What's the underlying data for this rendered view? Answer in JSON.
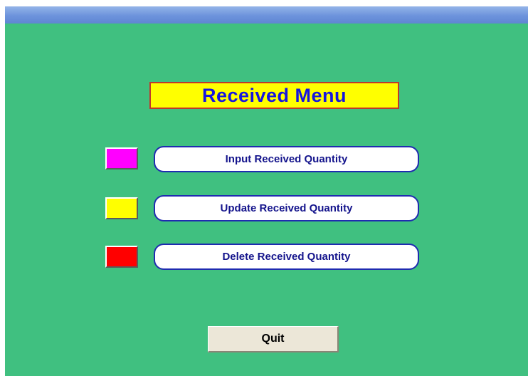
{
  "window": {
    "background": "#40c080",
    "titlebar_color": "#6d93dc"
  },
  "heading": {
    "text": "Received Menu",
    "background": "#ffff00",
    "text_color": "#1515e0"
  },
  "menu": {
    "items": [
      {
        "label": "Input Received Quantity",
        "swatch_color": "#ff00ff"
      },
      {
        "label": "Update Received Quantity",
        "swatch_color": "#ffff00"
      },
      {
        "label": "Delete Received Quantity",
        "swatch_color": "#ff0000"
      }
    ]
  },
  "quit": {
    "label": "Quit"
  }
}
